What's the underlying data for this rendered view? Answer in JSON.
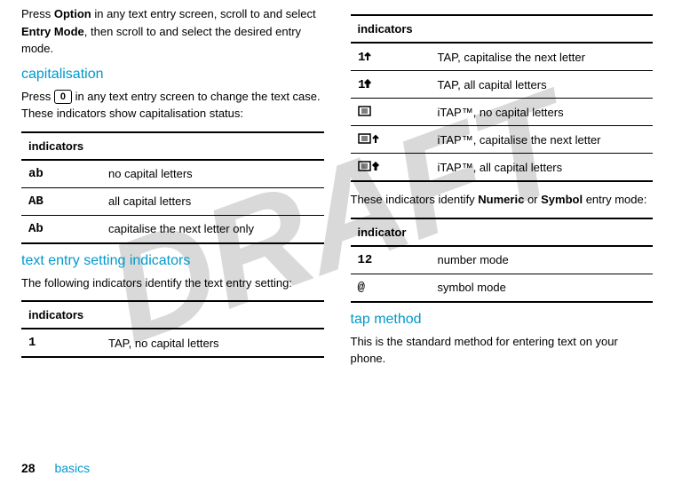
{
  "watermark": "DRAFT",
  "left": {
    "intro": {
      "t1": "Press ",
      "option": "Option",
      "t2": " in any text entry screen, scroll to and select ",
      "entrymode": "Entry Mode",
      "t3": ", then scroll to and select the desired entry mode."
    },
    "cap_heading": "capitalisation",
    "cap_para": {
      "t1": "Press ",
      "key": "0",
      "t2": " in any text entry screen to change the text case. These indicators show capitalisation status:"
    },
    "cap_table": {
      "header": "indicators",
      "rows": [
        {
          "icon": "ab",
          "desc": "no capital letters"
        },
        {
          "icon": "AB",
          "desc": "all capital letters"
        },
        {
          "icon": "Ab",
          "desc": "capitalise the next letter only"
        }
      ]
    },
    "tes_heading": "text entry setting indicators",
    "tes_para": "The following indicators identify the text entry setting:",
    "tes_table": {
      "header": "indicators",
      "rows": [
        {
          "icon": "1",
          "desc": "TAP, no capital letters"
        }
      ]
    }
  },
  "right": {
    "tes_cont": {
      "header": "indicators",
      "rows": [
        {
          "svg": "1up",
          "desc": "TAP, capitalise the next letter"
        },
        {
          "svg": "1cap",
          "desc": "TAP, all capital letters"
        },
        {
          "svg": "box",
          "desc": "iTAP™, no capital letters"
        },
        {
          "svg": "boxup",
          "desc": "iTAP™, capitalise the next letter"
        },
        {
          "svg": "boxcap",
          "desc": "iTAP™, all capital letters"
        }
      ]
    },
    "mode_para": {
      "t1": "These indicators identify ",
      "numeric": "Numeric",
      "t2": " or ",
      "symbol": "Symbol",
      "t3": " entry mode:"
    },
    "mode_table": {
      "header": "indicator",
      "rows": [
        {
          "icon": "12",
          "desc": "number mode"
        },
        {
          "icon": "@",
          "desc": "symbol mode"
        }
      ]
    },
    "tap_heading": "tap method",
    "tap_para": "This is the standard method for entering text on your phone."
  },
  "footer": {
    "page": "28",
    "section": "basics"
  }
}
